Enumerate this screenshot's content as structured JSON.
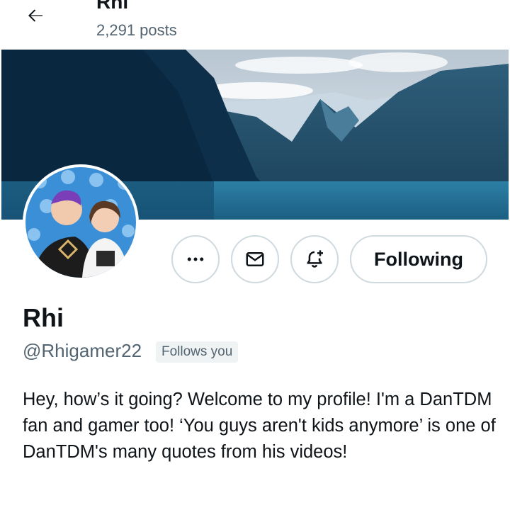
{
  "header": {
    "back_icon": "arrow-left-icon",
    "name": "Rhi",
    "posts_count": "2,291 posts"
  },
  "banner": {
    "description_icon": "mountain-lake-banner"
  },
  "profile": {
    "display_name": "Rhi",
    "handle": "@Rhigamer22",
    "follows_you": "Follows you",
    "bio": "Hey, how’s it going? Welcome to my profile! I'm a DanTDM fan and gamer too! ‘You guys aren't kids anymore’ is one of DanTDM's many quotes from his videos!"
  },
  "actions": {
    "more_icon": "more-dots-icon",
    "message_icon": "envelope-icon",
    "notify_icon": "bell-plus-icon",
    "following_label": "Following"
  },
  "colors": {
    "text": "#0f1419",
    "secondary": "#536471",
    "border": "#cfd9de",
    "badge_bg": "#eff3f4"
  }
}
